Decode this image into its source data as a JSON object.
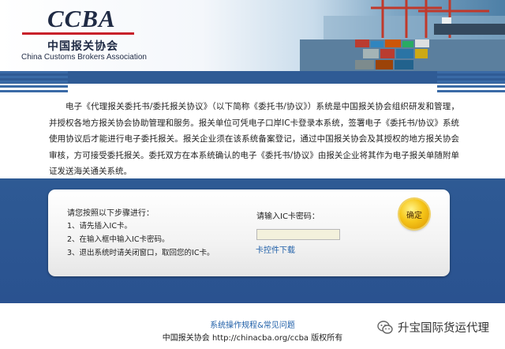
{
  "header": {
    "logo_brand": "CCBA",
    "logo_cn": "中国报关协会",
    "logo_en": "China Customs Brokers Association"
  },
  "intro": "电子《代理报关委托书/委托报关协议》（以下简称《委托书/协议》）系统是中国报关协会组织研发和管理，并授权各地方报关协会协助管理和服务。报关单位可凭电子口岸IC卡登录本系统，签署电子《委托书/协议》系统使用协议后才能进行电子委托报关。报关企业须在该系统备案登记，通过中国报关协会及其授权的地方报关协会审核，方可接受委托报关。委托双方在本系统确认的电子《委托书/协议》由报关企业将其作为电子报关单随附单证发送海关通关系统。",
  "login": {
    "steps_title": "请您按照以下步骤进行：",
    "steps": [
      "1、请先插入IC卡。",
      "2、在输入框中输入IC卡密码。",
      "3、退出系统时请关闭窗口，取回您的IC卡。"
    ],
    "password_label": "请输入IC卡密码：",
    "password_value": "",
    "ic_control_link": "卡控件下载",
    "ok_button": "确定"
  },
  "footer": {
    "help_link": "系统操作规程&常见问题",
    "copyright": "中国报关协会 http://chinacba.org/ccba 版权所有"
  },
  "watermark": {
    "icon": "wechat-icon",
    "text": "升宝国际货运代理"
  }
}
